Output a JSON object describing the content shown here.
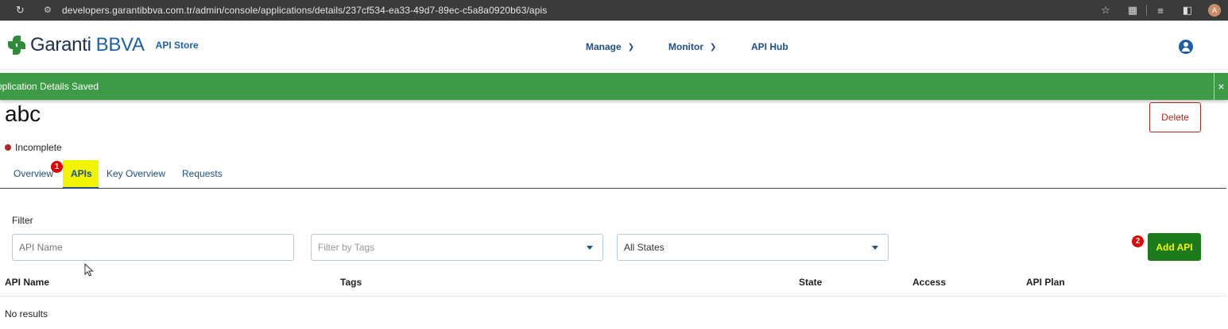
{
  "browser": {
    "url": "developers.garantibbva.com.tr/admin/console/applications/details/237cf534-ea33-49d7-89ec-c5a8a0920b63/apis",
    "profile_initial": "A"
  },
  "header": {
    "brand_name": "Garanti",
    "brand_suffix": "BBVA",
    "store_label": "API Store",
    "nav": [
      {
        "label": "Manage"
      },
      {
        "label": "Monitor"
      },
      {
        "label": "API Hub"
      }
    ]
  },
  "toast": {
    "message": "Application Details Saved",
    "close_glyph": "×"
  },
  "app": {
    "title": "abc",
    "status": "Incomplete",
    "delete_label": "Delete"
  },
  "tabs": [
    {
      "label": "Overview"
    },
    {
      "label": "APIs"
    },
    {
      "label": "Key Overview"
    },
    {
      "label": "Requests"
    }
  ],
  "steps": {
    "one": "1",
    "two": "2"
  },
  "filter": {
    "label": "Filter",
    "api_name_placeholder": "API Name",
    "tags_placeholder": "Filter by Tags",
    "state_value": "All States",
    "add_label": "Add API"
  },
  "table": {
    "columns": [
      "API Name",
      "Tags",
      "State",
      "Access",
      "API Plan"
    ],
    "empty_text": "No results"
  },
  "colors": {
    "toast_bg": "#3e9a47",
    "brand_blue": "#1d5fa8",
    "delete_red": "#b3261e",
    "highlight_yellow": "#f1f500",
    "add_button_green": "#1c7a1c"
  }
}
